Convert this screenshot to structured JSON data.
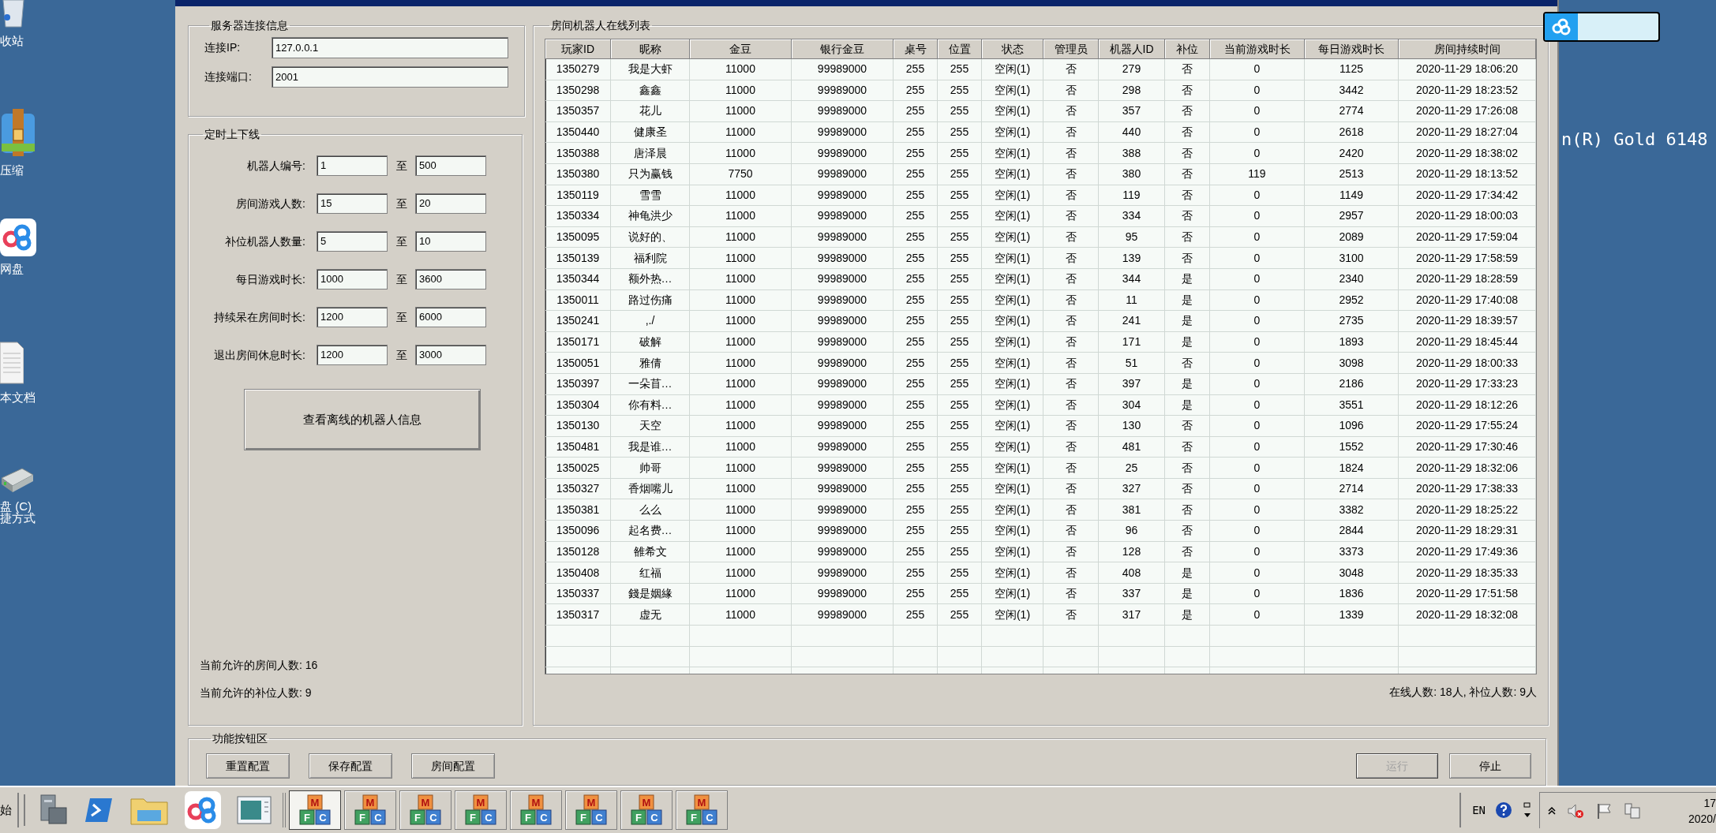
{
  "desktop": {
    "icons": [
      {
        "kind": "recycle",
        "lines": [
          "收站"
        ]
      },
      {
        "kind": "archive",
        "lines": [
          "压缩"
        ]
      },
      {
        "kind": "cloud",
        "lines": [
          "网盘"
        ]
      },
      {
        "kind": "document",
        "lines": [
          "本文档"
        ]
      },
      {
        "kind": "drive",
        "lines": [
          "盘 (C)",
          "捷方式"
        ]
      }
    ],
    "system_info": "n(R) Gold 6148"
  },
  "window": {
    "server_group": {
      "title": "服务器连接信息",
      "fields": [
        {
          "label": "连接IP:",
          "value": "127.0.0.1"
        },
        {
          "label": "连接端口:",
          "value": "2001"
        }
      ]
    },
    "schedule_group": {
      "title": "定时上下线",
      "ranges": [
        {
          "label": "机器人编号:",
          "from": "1",
          "sep": "至",
          "to": "500"
        },
        {
          "label": "房间游戏人数:",
          "from": "15",
          "sep": "至",
          "to": "20"
        },
        {
          "label": "补位机器人数量:",
          "from": "5",
          "sep": "至",
          "to": "10"
        },
        {
          "label": "每日游戏时长:",
          "from": "1000",
          "sep": "至",
          "to": "3600"
        },
        {
          "label": "持续呆在房间时长:",
          "from": "1200",
          "sep": "至",
          "to": "6000"
        },
        {
          "label": "退出房间休息时长:",
          "from": "1200",
          "sep": "至",
          "to": "3000"
        }
      ],
      "offline_button": "查看离线的机器人信息",
      "notes": [
        "当前允许的房间人数: 16",
        "当前允许的补位人数: 9"
      ]
    },
    "online_group": {
      "title": "房间机器人在线列表",
      "table": {
        "columns": [
          "玩家ID",
          "昵称",
          "金豆",
          "银行金豆",
          "桌号",
          "位置",
          "状态",
          "管理员",
          "机器人ID",
          "补位",
          "当前游戏时长",
          "每日游戏时长",
          "房间持续时间"
        ],
        "rows": [
          [
            "1350279",
            "我是大虾",
            "11000",
            "99989000",
            "255",
            "255",
            "空闲(1)",
            "否",
            "279",
            "否",
            "0",
            "1125",
            "2020-11-29 18:06:20"
          ],
          [
            "1350298",
            "鑫鑫",
            "11000",
            "99989000",
            "255",
            "255",
            "空闲(1)",
            "否",
            "298",
            "否",
            "0",
            "3442",
            "2020-11-29 18:23:52"
          ],
          [
            "1350357",
            "花儿",
            "11000",
            "99989000",
            "255",
            "255",
            "空闲(1)",
            "否",
            "357",
            "否",
            "0",
            "2774",
            "2020-11-29 17:26:08"
          ],
          [
            "1350440",
            "健康圣",
            "11000",
            "99989000",
            "255",
            "255",
            "空闲(1)",
            "否",
            "440",
            "否",
            "0",
            "2618",
            "2020-11-29 18:27:04"
          ],
          [
            "1350388",
            "唐泽晨",
            "11000",
            "99989000",
            "255",
            "255",
            "空闲(1)",
            "否",
            "388",
            "否",
            "0",
            "2420",
            "2020-11-29 18:38:02"
          ],
          [
            "1350380",
            "只为赢钱",
            "7750",
            "99989000",
            "255",
            "255",
            "空闲(1)",
            "否",
            "380",
            "否",
            "119",
            "2513",
            "2020-11-29 18:13:52"
          ],
          [
            "1350119",
            "雪雪",
            "11000",
            "99989000",
            "255",
            "255",
            "空闲(1)",
            "否",
            "119",
            "否",
            "0",
            "1149",
            "2020-11-29 17:34:42"
          ],
          [
            "1350334",
            "神龟洪少",
            "11000",
            "99989000",
            "255",
            "255",
            "空闲(1)",
            "否",
            "334",
            "否",
            "0",
            "2957",
            "2020-11-29 18:00:03"
          ],
          [
            "1350095",
            "说好的、",
            "11000",
            "99989000",
            "255",
            "255",
            "空闲(1)",
            "否",
            "95",
            "否",
            "0",
            "2089",
            "2020-11-29 17:59:04"
          ],
          [
            "1350139",
            "福利院",
            "11000",
            "99989000",
            "255",
            "255",
            "空闲(1)",
            "否",
            "139",
            "否",
            "0",
            "3100",
            "2020-11-29 17:58:59"
          ],
          [
            "1350344",
            "额外热…",
            "11000",
            "99989000",
            "255",
            "255",
            "空闲(1)",
            "否",
            "344",
            "是",
            "0",
            "2340",
            "2020-11-29 18:28:59"
          ],
          [
            "1350011",
            "路过伤痛",
            "11000",
            "99989000",
            "255",
            "255",
            "空闲(1)",
            "否",
            "11",
            "是",
            "0",
            "2952",
            "2020-11-29 17:40:08"
          ],
          [
            "1350241",
            ",./",
            "11000",
            "99989000",
            "255",
            "255",
            "空闲(1)",
            "否",
            "241",
            "是",
            "0",
            "2735",
            "2020-11-29 18:39:57"
          ],
          [
            "1350171",
            "破解",
            "11000",
            "99989000",
            "255",
            "255",
            "空闲(1)",
            "否",
            "171",
            "是",
            "0",
            "1893",
            "2020-11-29 18:45:44"
          ],
          [
            "1350051",
            "雅倩",
            "11000",
            "99989000",
            "255",
            "255",
            "空闲(1)",
            "否",
            "51",
            "否",
            "0",
            "3098",
            "2020-11-29 18:00:33"
          ],
          [
            "1350397",
            "一朵苜…",
            "11000",
            "99989000",
            "255",
            "255",
            "空闲(1)",
            "否",
            "397",
            "是",
            "0",
            "2186",
            "2020-11-29 17:33:23"
          ],
          [
            "1350304",
            "你有料…",
            "11000",
            "99989000",
            "255",
            "255",
            "空闲(1)",
            "否",
            "304",
            "是",
            "0",
            "3551",
            "2020-11-29 18:12:26"
          ],
          [
            "1350130",
            "天空",
            "11000",
            "99989000",
            "255",
            "255",
            "空闲(1)",
            "否",
            "130",
            "否",
            "0",
            "1096",
            "2020-11-29 17:55:24"
          ],
          [
            "1350481",
            "我是谁…",
            "11000",
            "99989000",
            "255",
            "255",
            "空闲(1)",
            "否",
            "481",
            "否",
            "0",
            "1552",
            "2020-11-29 17:30:46"
          ],
          [
            "1350025",
            "帅哥",
            "11000",
            "99989000",
            "255",
            "255",
            "空闲(1)",
            "否",
            "25",
            "否",
            "0",
            "1824",
            "2020-11-29 18:32:06"
          ],
          [
            "1350327",
            "香烟嘴儿",
            "11000",
            "99989000",
            "255",
            "255",
            "空闲(1)",
            "否",
            "327",
            "否",
            "0",
            "2714",
            "2020-11-29 17:38:33"
          ],
          [
            "1350381",
            "么么",
            "11000",
            "99989000",
            "255",
            "255",
            "空闲(1)",
            "否",
            "381",
            "否",
            "0",
            "3382",
            "2020-11-29 18:25:22"
          ],
          [
            "1350096",
            "起名费…",
            "11000",
            "99989000",
            "255",
            "255",
            "空闲(1)",
            "否",
            "96",
            "否",
            "0",
            "2844",
            "2020-11-29 18:29:31"
          ],
          [
            "1350128",
            "雒希文",
            "11000",
            "99989000",
            "255",
            "255",
            "空闲(1)",
            "否",
            "128",
            "否",
            "0",
            "3373",
            "2020-11-29 17:49:36"
          ],
          [
            "1350408",
            "红福",
            "11000",
            "99989000",
            "255",
            "255",
            "空闲(1)",
            "否",
            "408",
            "是",
            "0",
            "3048",
            "2020-11-29 18:35:33"
          ],
          [
            "1350337",
            "錢是姻緣",
            "11000",
            "99989000",
            "255",
            "255",
            "空闲(1)",
            "否",
            "337",
            "是",
            "0",
            "1836",
            "2020-11-29 17:51:58"
          ],
          [
            "1350317",
            "虚无",
            "11000",
            "99989000",
            "255",
            "255",
            "空闲(1)",
            "否",
            "317",
            "是",
            "0",
            "1339",
            "2020-11-29 18:32:08"
          ]
        ]
      },
      "summary": "在线人数: 18人, 补位人数: 9人"
    },
    "function_group": {
      "title": "功能按钮区",
      "left_buttons": [
        {
          "label": "重置配置",
          "disabled": false
        },
        {
          "label": "保存配置",
          "disabled": false
        },
        {
          "label": "房间配置",
          "disabled": false
        }
      ],
      "right_buttons": [
        {
          "label": "运行",
          "disabled": true
        },
        {
          "label": "停止",
          "disabled": false
        }
      ]
    }
  },
  "taskbar": {
    "start_label": "始",
    "quick_launch": [
      {
        "kind": "server"
      },
      {
        "kind": "shell"
      },
      {
        "kind": "folder"
      },
      {
        "kind": "cloud"
      },
      {
        "kind": "window"
      }
    ],
    "app_buttons": [
      {
        "selected": true,
        "letters": [
          "M",
          "F",
          "C"
        ]
      },
      {
        "selected": false,
        "letters": [
          "M",
          "F",
          "C"
        ]
      },
      {
        "selected": false,
        "letters": [
          "M",
          "F",
          "C"
        ]
      },
      {
        "selected": false,
        "letters": [
          "M",
          "F",
          "C"
        ]
      },
      {
        "selected": false,
        "letters": [
          "M",
          "F",
          "C"
        ]
      },
      {
        "selected": false,
        "letters": [
          "M",
          "F",
          "C"
        ]
      },
      {
        "selected": false,
        "letters": [
          "M",
          "F",
          "C"
        ]
      },
      {
        "selected": false,
        "letters": [
          "M",
          "F",
          "C"
        ]
      }
    ],
    "language": "EN",
    "clock": [
      "17",
      "2020/"
    ]
  }
}
